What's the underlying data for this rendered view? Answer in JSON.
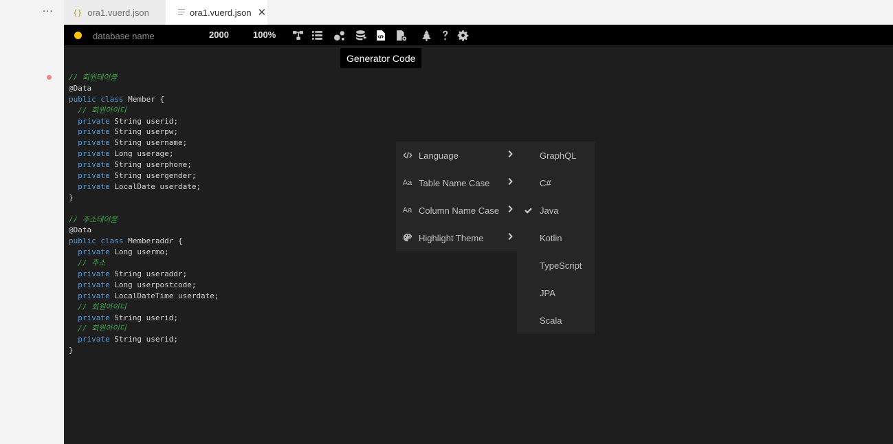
{
  "tabs": [
    {
      "label": "ora1.vuerd.json",
      "icon": "json-braces-icon",
      "active": false
    },
    {
      "label": "ora1.vuerd.json",
      "icon": "file-lines-icon",
      "active": true
    }
  ],
  "gutter": {
    "more_label": "···"
  },
  "toolbar": {
    "db_name_placeholder": "database name",
    "canvas_size": "2000",
    "zoom": "100%",
    "status_color": "#ffc107",
    "icons": [
      "relationship-icon",
      "list-icon",
      "visualization-icon",
      "database-import-icon",
      "generator-code-icon",
      "file-settings-icon",
      "tree-icon",
      "help-icon",
      "settings-icon"
    ]
  },
  "tooltip": {
    "text": "Generator Code"
  },
  "code_lines": [
    [
      {
        "t": "// 회원테이블",
        "c": "c"
      }
    ],
    [
      {
        "t": "@Data",
        "c": "a"
      }
    ],
    [
      {
        "t": "public class",
        "c": "k"
      },
      {
        "t": " Member {",
        "c": "a"
      }
    ],
    [
      {
        "t": "  ",
        "c": "a"
      },
      {
        "t": "// 회원아이디",
        "c": "c"
      }
    ],
    [
      {
        "t": "  ",
        "c": "a"
      },
      {
        "t": "private",
        "c": "k"
      },
      {
        "t": " String userid;",
        "c": "a"
      }
    ],
    [
      {
        "t": "  ",
        "c": "a"
      },
      {
        "t": "private",
        "c": "k"
      },
      {
        "t": " String userpw;",
        "c": "a"
      }
    ],
    [
      {
        "t": "  ",
        "c": "a"
      },
      {
        "t": "private",
        "c": "k"
      },
      {
        "t": " String username;",
        "c": "a"
      }
    ],
    [
      {
        "t": "  ",
        "c": "a"
      },
      {
        "t": "private",
        "c": "k"
      },
      {
        "t": " Long userage;",
        "c": "a"
      }
    ],
    [
      {
        "t": "  ",
        "c": "a"
      },
      {
        "t": "private",
        "c": "k"
      },
      {
        "t": " String userphone;",
        "c": "a"
      }
    ],
    [
      {
        "t": "  ",
        "c": "a"
      },
      {
        "t": "private",
        "c": "k"
      },
      {
        "t": " String usergender;",
        "c": "a"
      }
    ],
    [
      {
        "t": "  ",
        "c": "a"
      },
      {
        "t": "private",
        "c": "k"
      },
      {
        "t": " LocalDate userdate;",
        "c": "a"
      }
    ],
    [
      {
        "t": "}",
        "c": "a"
      }
    ],
    [
      {
        "t": "",
        "c": "a"
      }
    ],
    [
      {
        "t": "// 주소테이블",
        "c": "c"
      }
    ],
    [
      {
        "t": "@Data",
        "c": "a"
      }
    ],
    [
      {
        "t": "public class",
        "c": "k"
      },
      {
        "t": " Memberaddr {",
        "c": "a"
      }
    ],
    [
      {
        "t": "  ",
        "c": "a"
      },
      {
        "t": "private",
        "c": "k"
      },
      {
        "t": " Long usermo;",
        "c": "a"
      }
    ],
    [
      {
        "t": "  ",
        "c": "a"
      },
      {
        "t": "// 주소",
        "c": "c"
      }
    ],
    [
      {
        "t": "  ",
        "c": "a"
      },
      {
        "t": "private",
        "c": "k"
      },
      {
        "t": " String useraddr;",
        "c": "a"
      }
    ],
    [
      {
        "t": "  ",
        "c": "a"
      },
      {
        "t": "private",
        "c": "k"
      },
      {
        "t": " Long userpostcode;",
        "c": "a"
      }
    ],
    [
      {
        "t": "  ",
        "c": "a"
      },
      {
        "t": "private",
        "c": "k"
      },
      {
        "t": " LocalDateTime userdate;",
        "c": "a"
      }
    ],
    [
      {
        "t": "  ",
        "c": "a"
      },
      {
        "t": "// 회원아이디",
        "c": "c"
      }
    ],
    [
      {
        "t": "  ",
        "c": "a"
      },
      {
        "t": "private",
        "c": "k"
      },
      {
        "t": " String userid;",
        "c": "a"
      }
    ],
    [
      {
        "t": "  ",
        "c": "a"
      },
      {
        "t": "// 회원아이디",
        "c": "c"
      }
    ],
    [
      {
        "t": "  ",
        "c": "a"
      },
      {
        "t": "private",
        "c": "k"
      },
      {
        "t": " String userid;",
        "c": "a"
      }
    ],
    [
      {
        "t": "}",
        "c": "a"
      }
    ]
  ],
  "menu": {
    "items": [
      {
        "label": "Language",
        "icon": "code-icon"
      },
      {
        "label": "Table Name Case",
        "icon": "text-case-icon",
        "icon_text": "Aa"
      },
      {
        "label": "Column Name Case",
        "icon": "text-case-icon",
        "icon_text": "Aa"
      },
      {
        "label": "Highlight Theme",
        "icon": "palette-icon"
      }
    ]
  },
  "submenu": {
    "items": [
      {
        "label": "GraphQL",
        "checked": false
      },
      {
        "label": "C#",
        "checked": false
      },
      {
        "label": "Java",
        "checked": true
      },
      {
        "label": "Kotlin",
        "checked": false
      },
      {
        "label": "TypeScript",
        "checked": false
      },
      {
        "label": "JPA",
        "checked": false
      },
      {
        "label": "Scala",
        "checked": false
      }
    ]
  }
}
